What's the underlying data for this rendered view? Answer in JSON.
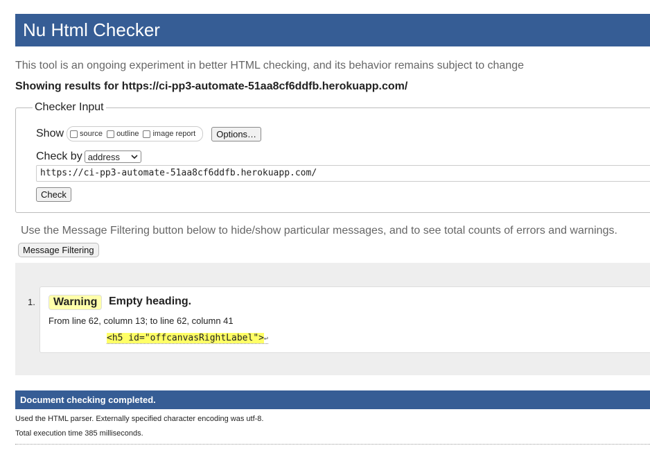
{
  "header": {
    "title": "Nu Html Checker"
  },
  "intro": "This tool is an ongoing experiment in better HTML checking, and its behavior remains subject to change",
  "showing": "Showing results for https://ci-pp3-automate-51aa8cf6ddfb.herokuapp.com/",
  "checker": {
    "legend": "Checker Input",
    "show_label": "Show",
    "show_options": [
      "source",
      "outline",
      "image report"
    ],
    "options_button": "Options…",
    "check_by_label": "Check by",
    "check_by_value": "address",
    "url_value": "https://ci-pp3-automate-51aa8cf6ddfb.herokuapp.com/",
    "check_button": "Check"
  },
  "filtering": {
    "text": "Use the Message Filtering button below to hide/show particular messages, and to see total counts of errors and warnings.",
    "button": "Message Filtering"
  },
  "messages": [
    {
      "number": "1.",
      "type": "Warning",
      "title": "Empty heading.",
      "location": "From line 62, column 13; to line 62, column 41",
      "code": "<h5 id=\"offcanvasRightLabel\">"
    }
  ],
  "footer": {
    "status": "Document checking completed.",
    "parser_note": "Used the HTML parser. Externally specified character encoding was utf-8.",
    "timing": "Total execution time 385 milliseconds."
  },
  "colors": {
    "accent": "#365d95",
    "warning": "#ffffaa",
    "highlight": "#ffff66"
  }
}
